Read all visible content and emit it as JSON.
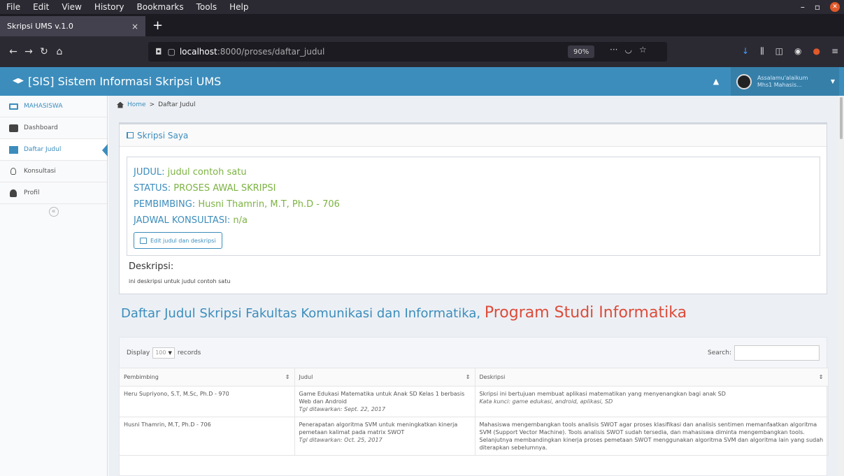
{
  "browser": {
    "menu": [
      "File",
      "Edit",
      "View",
      "History",
      "Bookmarks",
      "Tools",
      "Help"
    ],
    "tab_title": "Skripsi UMS v.1.0",
    "tab_close": "×",
    "new_tab": "+",
    "url_host": "localhost",
    "url_path": ":8000/proses/daftar_judul",
    "zoom": "90%",
    "url_more": "···"
  },
  "app": {
    "brand": "[SIS] Sistem Informasi Skripsi UMS",
    "user_line1": "Assalamu'alaikum",
    "user_line2": "Mhs1 Mahasis..."
  },
  "sidebar": {
    "items": [
      {
        "label": "MAHASISWA"
      },
      {
        "label": "Dashboard"
      },
      {
        "label": "Daftar Judul"
      },
      {
        "label": "Konsultasi"
      },
      {
        "label": "Profil"
      }
    ],
    "collapse": "«"
  },
  "breadcrumb": {
    "home": "Home",
    "sep": ">",
    "current": "Daftar Judul"
  },
  "skripsi": {
    "title": "Skripsi Saya",
    "judul_label": "JUDUL:",
    "judul_value": "judul contoh satu",
    "status_label": "STATUS:",
    "status_value": "PROSES AWAL SKRIPSI",
    "pembimbing_label": "PEMBIMBING:",
    "pembimbing_value": "Husni Thamrin, M.T, Ph.D - 706",
    "jadwal_label": "JADWAL KONSULTASI:",
    "jadwal_value": "n/a",
    "edit_button": "Edit judul dan deskripsi",
    "desc_label": "Deskripsi:",
    "desc_text": "ini deskripsi untuk judul contoh satu"
  },
  "section": {
    "title_prefix": "Daftar Judul Skripsi Fakultas Komunikasi dan Informatika,",
    "title_program": "Program Studi Informatika"
  },
  "table": {
    "display_label": "Display",
    "display_value": "100",
    "records_label": "records",
    "search_label": "Search:",
    "columns": [
      "Pembimbing",
      "Judul",
      "Deskripsi"
    ],
    "rows": [
      {
        "pembimbing": "Heru Supriyono, S.T, M.Sc, Ph.D - 970",
        "judul": "Game Edukasi Matematika untuk Anak SD Kelas 1 berbasis Web dan Android",
        "tgl": "Tgl ditawarkan: Sept. 22, 2017",
        "deskripsi": "Skripsi ini bertujuan membuat aplikasi matematikan yang menyenangkan bagi anak SD",
        "kata_kunci": "Kata kunci: game edukasi, android, aplikasi, SD"
      },
      {
        "pembimbing": "Husni Thamrin, M.T, Ph.D - 706",
        "judul": "Penerapatan algoritma SVM untuk meningkatkan kinerja pemetaan kalimat pada matrix SWOT",
        "tgl": "Tgl ditawarkan: Oct. 25, 2017",
        "deskripsi": "Mahasiswa mengembangkan tools analisis SWOT agar proses klasifikasi dan analisis sentimen memanfaatkan algoritma SVM (Support Vector Machine). Tools analisis SWOT sudah tersedia, dan mahasiswa diminta mengembangkan tools. Selanjutnya membandingkan kinerja proses pemetaan SWOT menggunakan algoritma SVM dan algoritma lain yang sudah diterapkan sebelumnya.",
        "kata_kunci": ""
      }
    ]
  }
}
